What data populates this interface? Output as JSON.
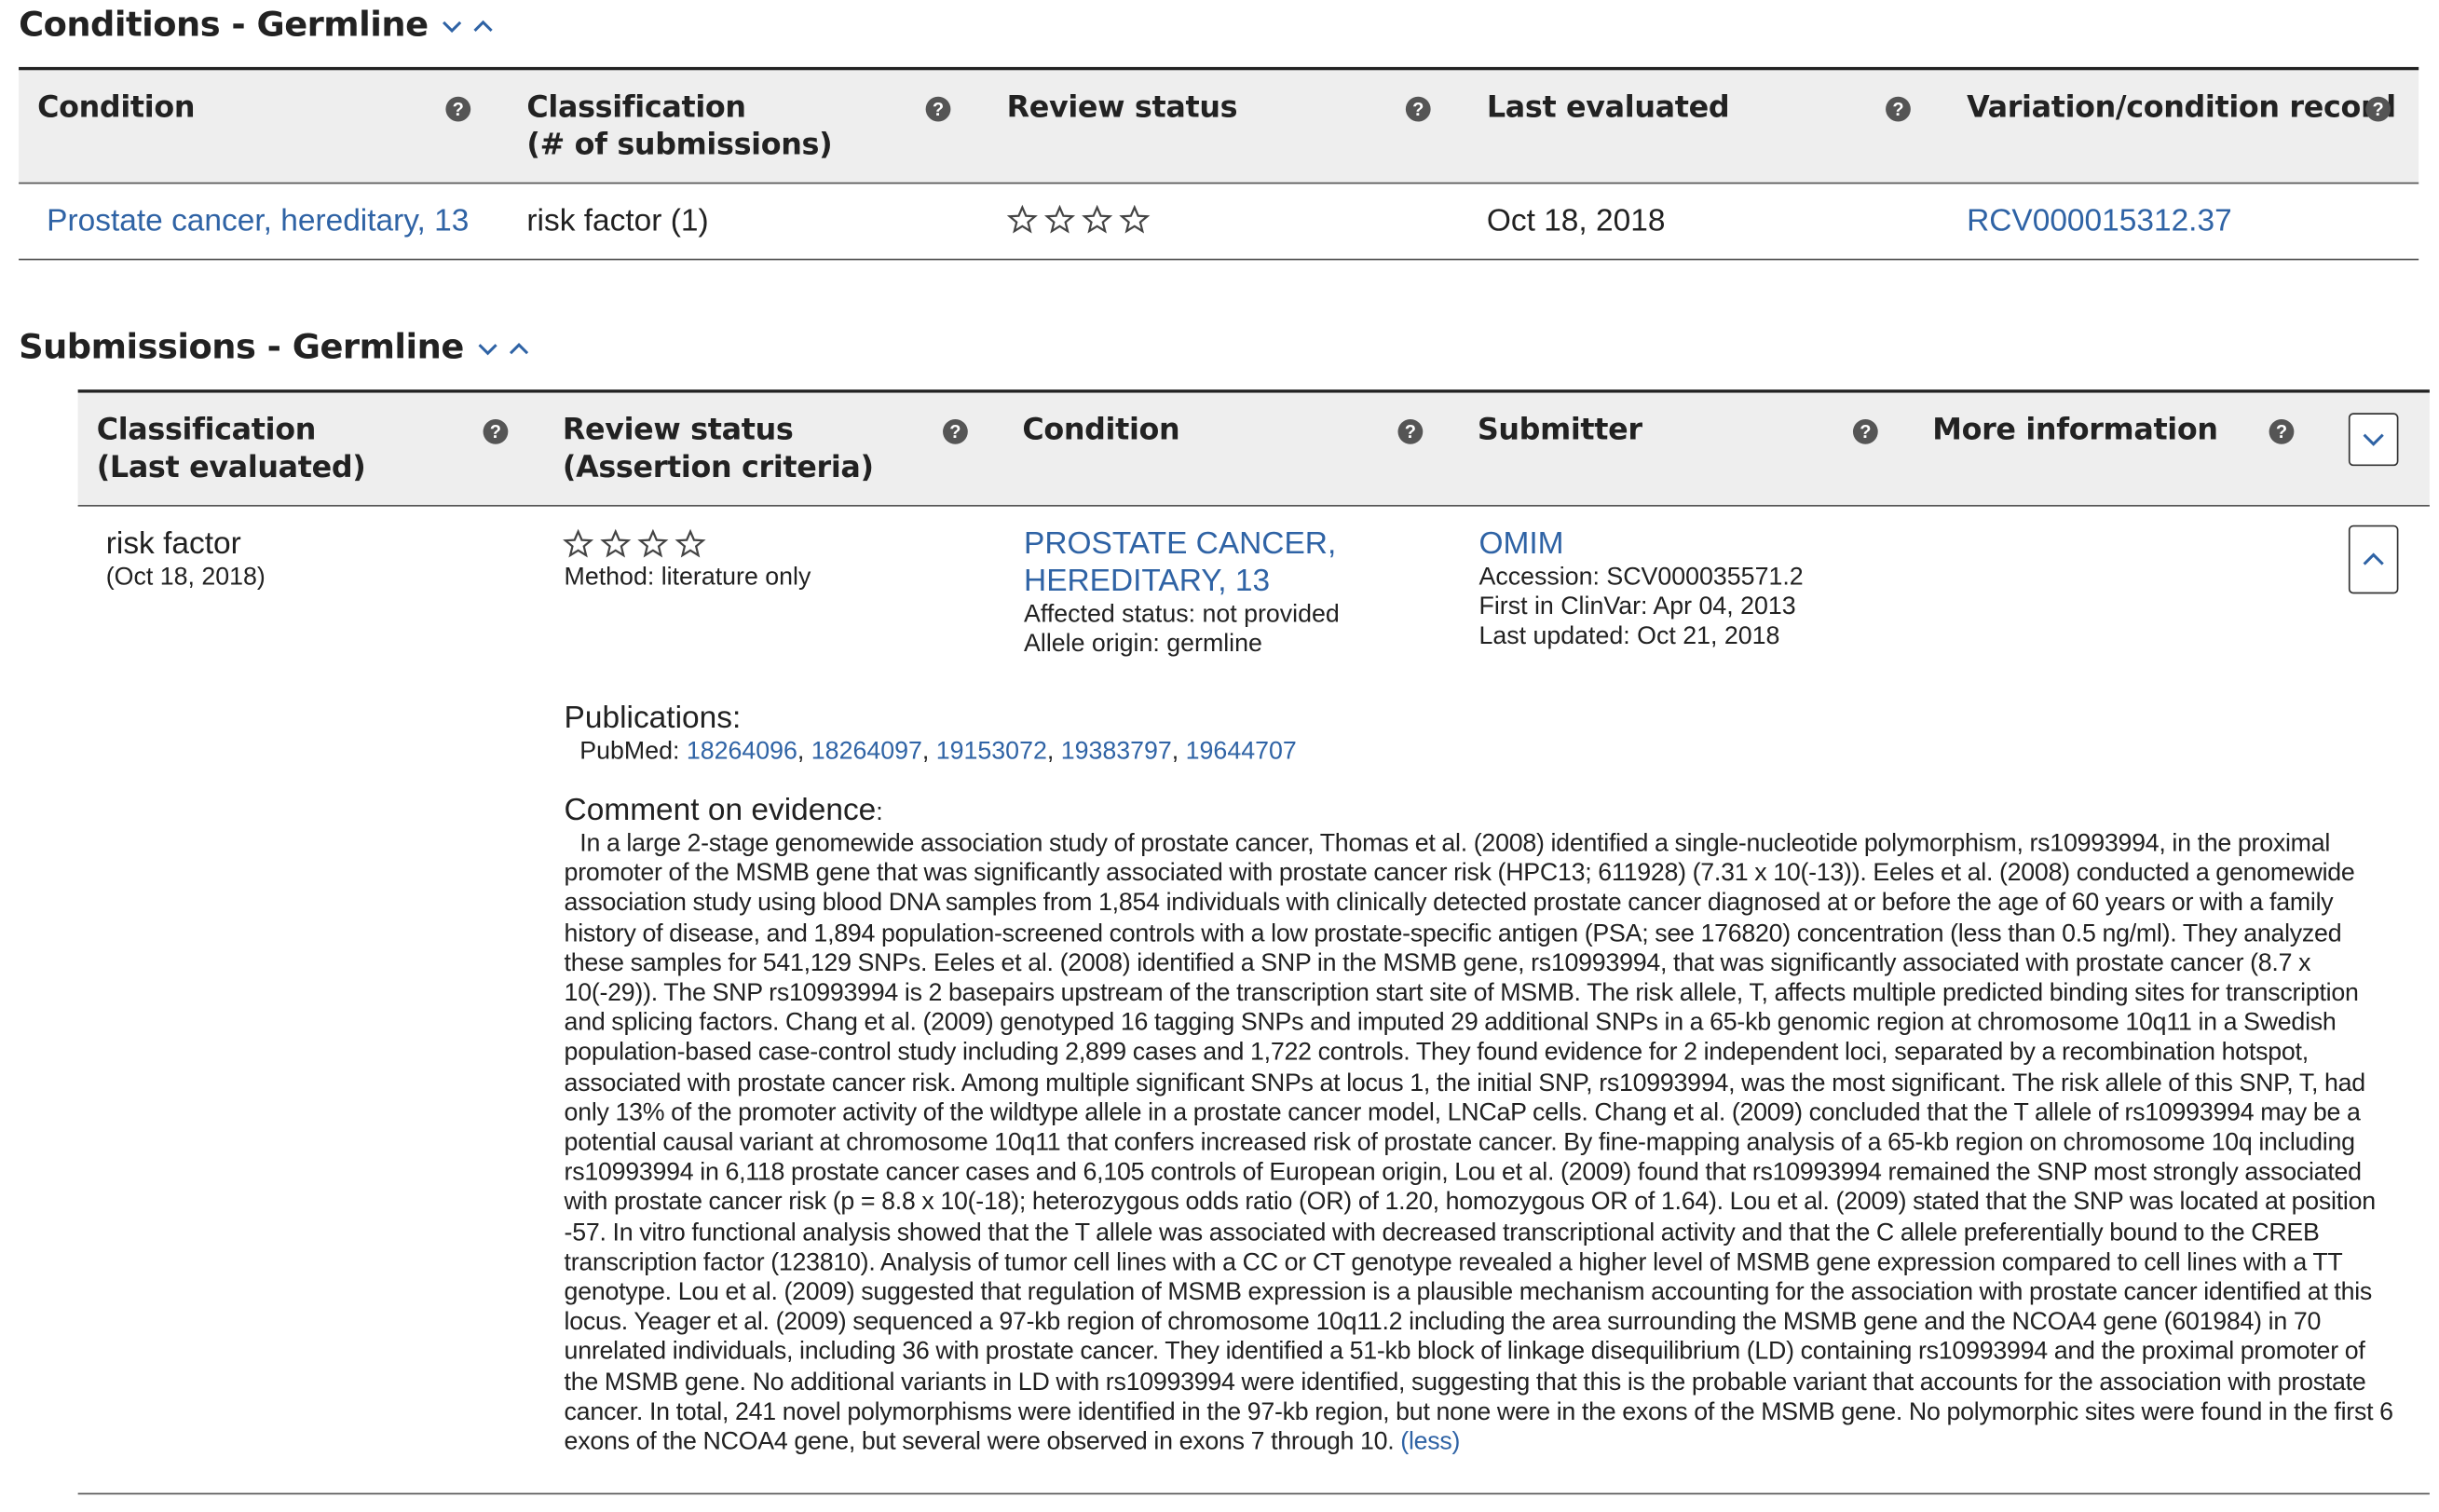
{
  "conditions": {
    "title": "Conditions - Germline",
    "headers": [
      "Condition",
      "Classification",
      "(# of submissions)",
      "Review status",
      "Last evaluated",
      "Variation/condition record"
    ],
    "row": {
      "condition": "Prostate cancer, hereditary, 13",
      "classification": "risk factor (1)",
      "review_stars": 0,
      "last_evaluated": "Oct 18, 2018",
      "record": "RCV000015312.37"
    }
  },
  "submissions": {
    "title": "Submissions - Germline",
    "headers": {
      "classification_l1": "Classification",
      "classification_l2": "(Last evaluated)",
      "review_l1": "Review status",
      "review_l2": "(Assertion criteria)",
      "condition": "Condition",
      "submitter": "Submitter",
      "more_info": "More information"
    },
    "row": {
      "classification": "risk factor",
      "date": "(Oct 18, 2018)",
      "review_stars": 0,
      "method": "Method: literature only",
      "condition_l1": "PROSTATE CANCER,",
      "condition_l2": "HEREDITARY, 13",
      "affected_status": "Affected status: not provided",
      "allele_origin": "Allele origin: germline",
      "submitter": "OMIM",
      "accession": "Accession: SCV000035571.2",
      "first_in": "First in ClinVar: Apr 04, 2013",
      "last_updated": "Last updated: Oct 21, 2018"
    },
    "publications_label": "Publications:",
    "pubmed_label": "PubMed: ",
    "pubmed_ids": [
      "18264096",
      "18264097",
      "19153072",
      "19383797",
      "19644707"
    ],
    "comment_label": "Comment on evidence",
    "comment_colon": ":",
    "comment": "In a large 2-stage genomewide association study of prostate cancer, Thomas et al. (2008) identified a single-nucleotide polymorphism, rs10993994, in the proximal promoter of the MSMB gene that was significantly associated with prostate cancer risk (HPC13; 611928) (7.31 x 10(-13)). Eeles et al. (2008) conducted a genomewide association study using blood DNA samples from 1,854 individuals with clinically detected prostate cancer diagnosed at or before the age of 60 years or with a family history of disease, and 1,894 population-screened controls with a low prostate-specific antigen (PSA; see 176820) concentration (less than 0.5 ng/ml). They analyzed these samples for 541,129 SNPs. Eeles et al. (2008) identified a SNP in the MSMB gene, rs10993994, that was significantly associated with prostate cancer (8.7 x 10(-29)). The SNP rs10993994 is 2 basepairs upstream of the transcription start site of MSMB. The risk allele, T, affects multiple predicted binding sites for transcription and splicing factors. Chang et al. (2009) genotyped 16 tagging SNPs and imputed 29 additional SNPs in a 65-kb genomic region at chromosome 10q11 in a Swedish population-based case-control study including 2,899 cases and 1,722 controls. They found evidence for 2 independent loci, separated by a recombination hotspot, associated with prostate cancer risk. Among multiple significant SNPs at locus 1, the initial SNP, rs10993994, was the most significant. The risk allele of this SNP, T, had only 13% of the promoter activity of the wildtype allele in a prostate cancer model, LNCaP cells. Chang et al. (2009) concluded that the T allele of rs10993994 may be a potential causal variant at chromosome 10q11 that confers increased risk of prostate cancer. By fine-mapping analysis of a 65-kb region on chromosome 10q including rs10993994 in 6,118 prostate cancer cases and 6,105 controls of European origin, Lou et al. (2009) found that rs10993994 remained the SNP most strongly associated with prostate cancer risk (p = 8.8 x 10(-18); heterozygous odds ratio (OR) of 1.20, homozygous OR of 1.64). Lou et al. (2009) stated that the SNP was located at position -57. In vitro functional analysis showed that the T allele was associated with decreased transcriptional activity and that the C allele preferentially bound to the CREB transcription factor (123810). Analysis of tumor cell lines with a CC or CT genotype revealed a higher level of MSMB gene expression compared to cell lines with a TT genotype. Lou et al. (2009) suggested that regulation of MSMB expression is a plausible mechanism accounting for the association with prostate cancer identified at this locus. Yeager et al. (2009) sequenced a 97-kb region of chromosome 10q11.2 including the area surrounding the MSMB gene and the NCOA4 gene (601984) in 70 unrelated individuals, including 36 with prostate cancer. They identified a 51-kb block of linkage disequilibrium (LD) containing rs10993994 and the proximal promoter of the MSMB gene. No additional variants in LD with rs10993994 were identified, suggesting that this is the probable variant that accounts for the association with prostate cancer. In total, 241 novel polymorphisms were identified in the 97-kb region, but none were in the exons of the MSMB gene. No polymorphic sites were found in the first 6 exons of the NCOA4 gene, but several were observed in exons 7 through 10.",
    "less_link": "(less)"
  },
  "colors": {
    "link": "#2f63a5",
    "header_bg": "#eeeeee",
    "text": "#212121"
  }
}
